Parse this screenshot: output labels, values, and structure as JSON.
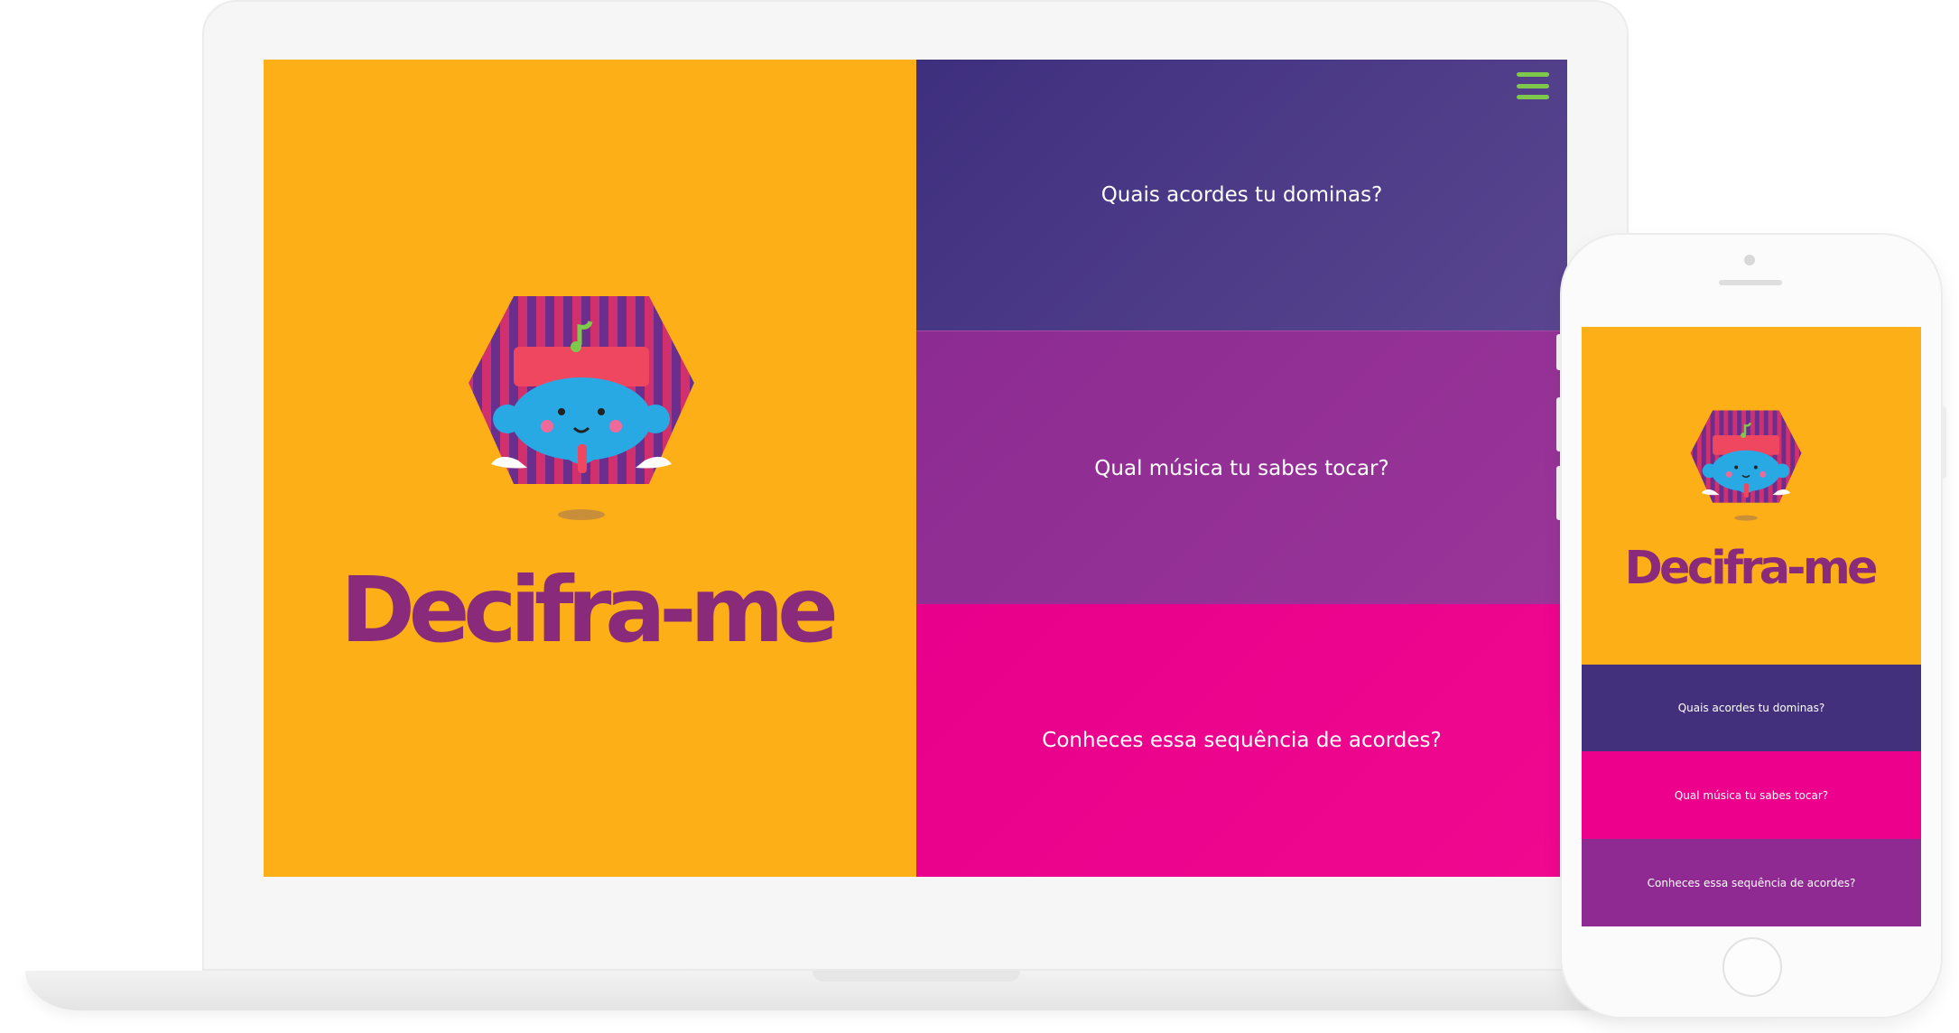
{
  "brand": {
    "name": "Decifra-me",
    "colors": {
      "orange": "#fcaf17",
      "indigo": "#4a3884",
      "purple": "#93309a",
      "magenta": "#ec008c",
      "logo_text": "#8a2a7a",
      "menu_green": "#7ec84b"
    }
  },
  "desktop": {
    "menu_icon": "hamburger-menu-icon",
    "options": [
      {
        "label": "Quais acordes tu dominas?"
      },
      {
        "label": "Qual música tu sabes tocar?"
      },
      {
        "label": "Conheces essa sequência de acordes?"
      }
    ]
  },
  "mobile": {
    "options": [
      {
        "label": "Quais acordes tu dominas?"
      },
      {
        "label": "Qual música tu sabes tocar?"
      },
      {
        "label": "Conheces essa sequência de acordes?"
      }
    ]
  }
}
